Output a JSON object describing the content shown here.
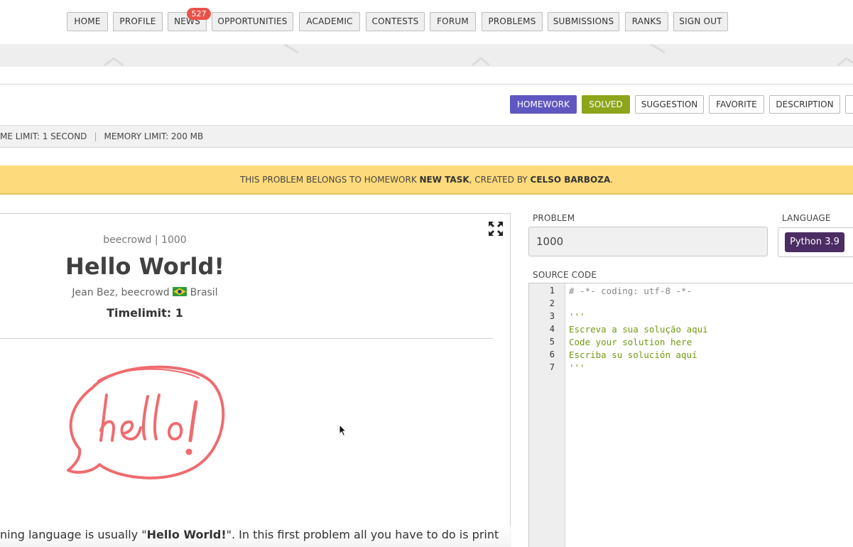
{
  "nav": {
    "items": [
      "HOME",
      "PROFILE",
      "NEWS",
      "OPPORTUNITIES",
      "ACADEMIC",
      "CONTESTS",
      "FORUM",
      "PROBLEMS",
      "SUBMISSIONS",
      "RANKS",
      "SIGN OUT"
    ],
    "news_badge": "527"
  },
  "actions": {
    "homework": "HOMEWORK",
    "solved": "SOLVED",
    "suggestion": "SUGGESTION",
    "favorite": "FAVORITE",
    "description": "DESCRIPTION"
  },
  "limits": {
    "time": "ME LIMIT: 1 SECOND",
    "memory": "MEMORY LIMIT: 200 MB"
  },
  "homework_notice": {
    "prefix": "THIS PROBLEM BELONGS TO HOMEWORK ",
    "task": "NEW TASK",
    "middle": ", CREATED BY ",
    "creator": "CELSO BARBOZA",
    "suffix": "."
  },
  "problem": {
    "origin": "beecrowd | 1000",
    "title": "Hello World!",
    "author": "Jean Bez, beecrowd",
    "country": "Brasil",
    "timelimit": "Timelimit: 1",
    "desc_prefix": "ning language is usually \"",
    "desc_bold": "Hello World!",
    "desc_suffix": "\". In this first problem all you have to do is print"
  },
  "editor_panel": {
    "problem_label": "PROBLEM",
    "problem_value": "1000",
    "language_label": "LANGUAGE",
    "language_value": "Python 3.9",
    "source_label": "SOURCE CODE",
    "lines": [
      {
        "n": "1",
        "text": "# -*- coding: utf-8 -*-",
        "kind": "comment"
      },
      {
        "n": "2",
        "text": "",
        "kind": "str"
      },
      {
        "n": "3",
        "text": "'''",
        "kind": "str"
      },
      {
        "n": "4",
        "text": "Escreva a sua solução aqui",
        "kind": "str"
      },
      {
        "n": "5",
        "text": "Code your solution here",
        "kind": "str"
      },
      {
        "n": "6",
        "text": "Escriba su solución aquí",
        "kind": "str"
      },
      {
        "n": "7",
        "text": "'''",
        "kind": "str"
      }
    ]
  },
  "colors": {
    "homework_btn": "#5f57c0",
    "solved_btn": "#8ca51b",
    "notice_bg": "#fdda7b",
    "language_chip": "#4b2d63",
    "badge": "#e9524a",
    "hello_art": "#ef6b6f"
  }
}
